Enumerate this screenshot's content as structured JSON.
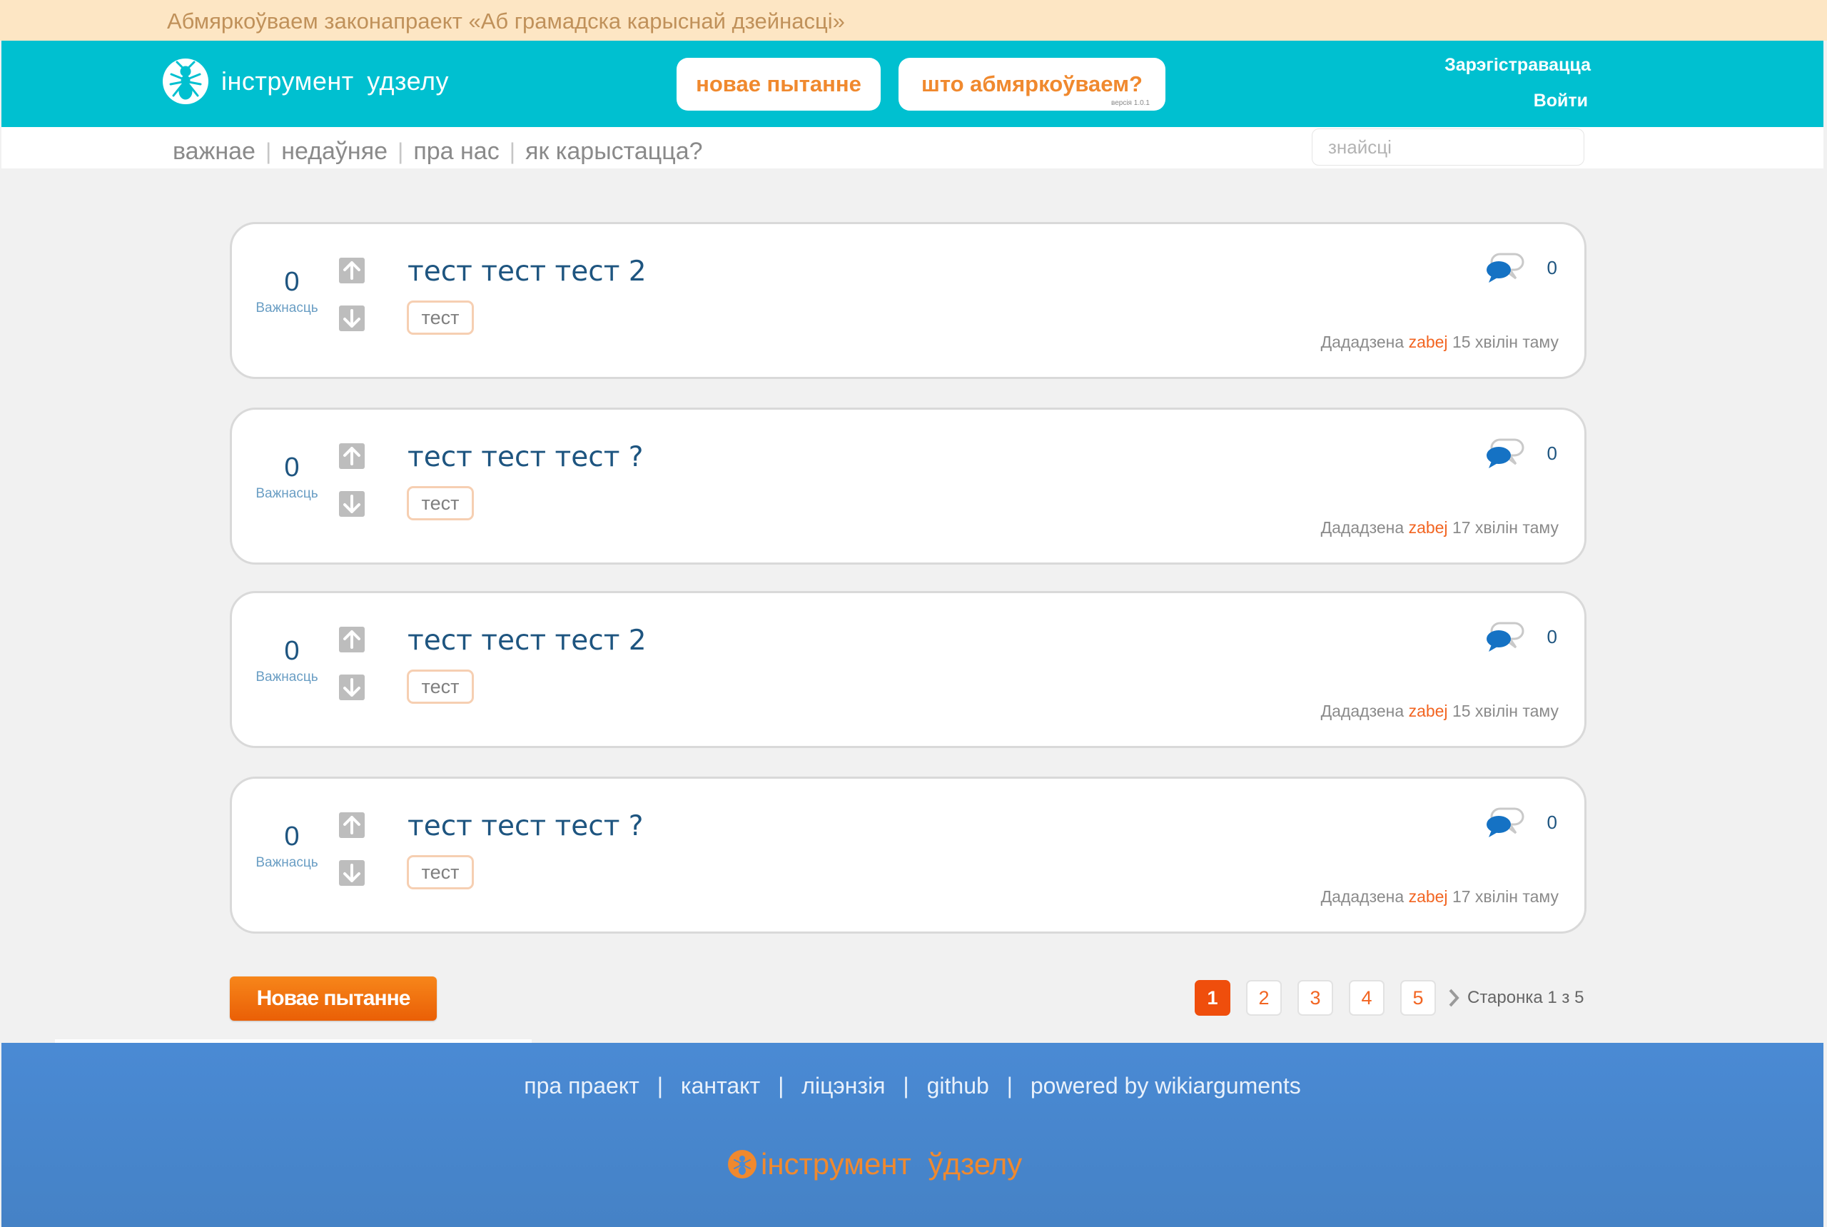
{
  "announce": "Абмяркоўваем законапраект «Аб грамадска карыснай дзейнасці»",
  "header": {
    "logo_text": "інструмент  удзелу",
    "new_question": "новае пытанне",
    "discussing": "што абмяркоўваем?",
    "version": "версія 1.0.1",
    "register": "Зарэгістравацца",
    "login": "Войти"
  },
  "nav": {
    "items": [
      "важнае",
      "недаўняе",
      "пра нас",
      "як карыстацца?"
    ],
    "search_placeholder": "знайсці"
  },
  "questions": [
    {
      "score": "0",
      "score_label": "Важнасць",
      "title": "тест тест тест 2",
      "tag": "тест",
      "comments": "0",
      "added": "Дададзена",
      "user": "zabej",
      "time": "15 хвілін таму"
    },
    {
      "score": "0",
      "score_label": "Важнасць",
      "title": "тест тест тест ?",
      "tag": "тест",
      "comments": "0",
      "added": "Дададзена",
      "user": "zabej",
      "time": "17 хвілін таму"
    },
    {
      "score": "0",
      "score_label": "Важнасць",
      "title": "тест тест тест 2",
      "tag": "тест",
      "comments": "0",
      "added": "Дададзена",
      "user": "zabej",
      "time": "15 хвілін таму"
    },
    {
      "score": "0",
      "score_label": "Важнасць",
      "title": "тест тест тест ?",
      "tag": "тест",
      "comments": "0",
      "added": "Дададзена",
      "user": "zabej",
      "time": "17 хвілін таму"
    }
  ],
  "new_question_button": "Новае пытанне",
  "pager": {
    "pages": [
      "1",
      "2",
      "3",
      "4",
      "5"
    ],
    "active": "1",
    "info": "Старонка 1 з 5"
  },
  "footer": {
    "links": [
      "пра праект",
      "кантакт",
      "ліцэнзія",
      "github",
      "powered by wikiarguments"
    ],
    "logo_text": "інструмент  ўдзелу"
  },
  "colors": {
    "header": "#00c0d0",
    "accent": "#f26522",
    "footer": "#4a8ad4",
    "title": "#1e5580"
  }
}
